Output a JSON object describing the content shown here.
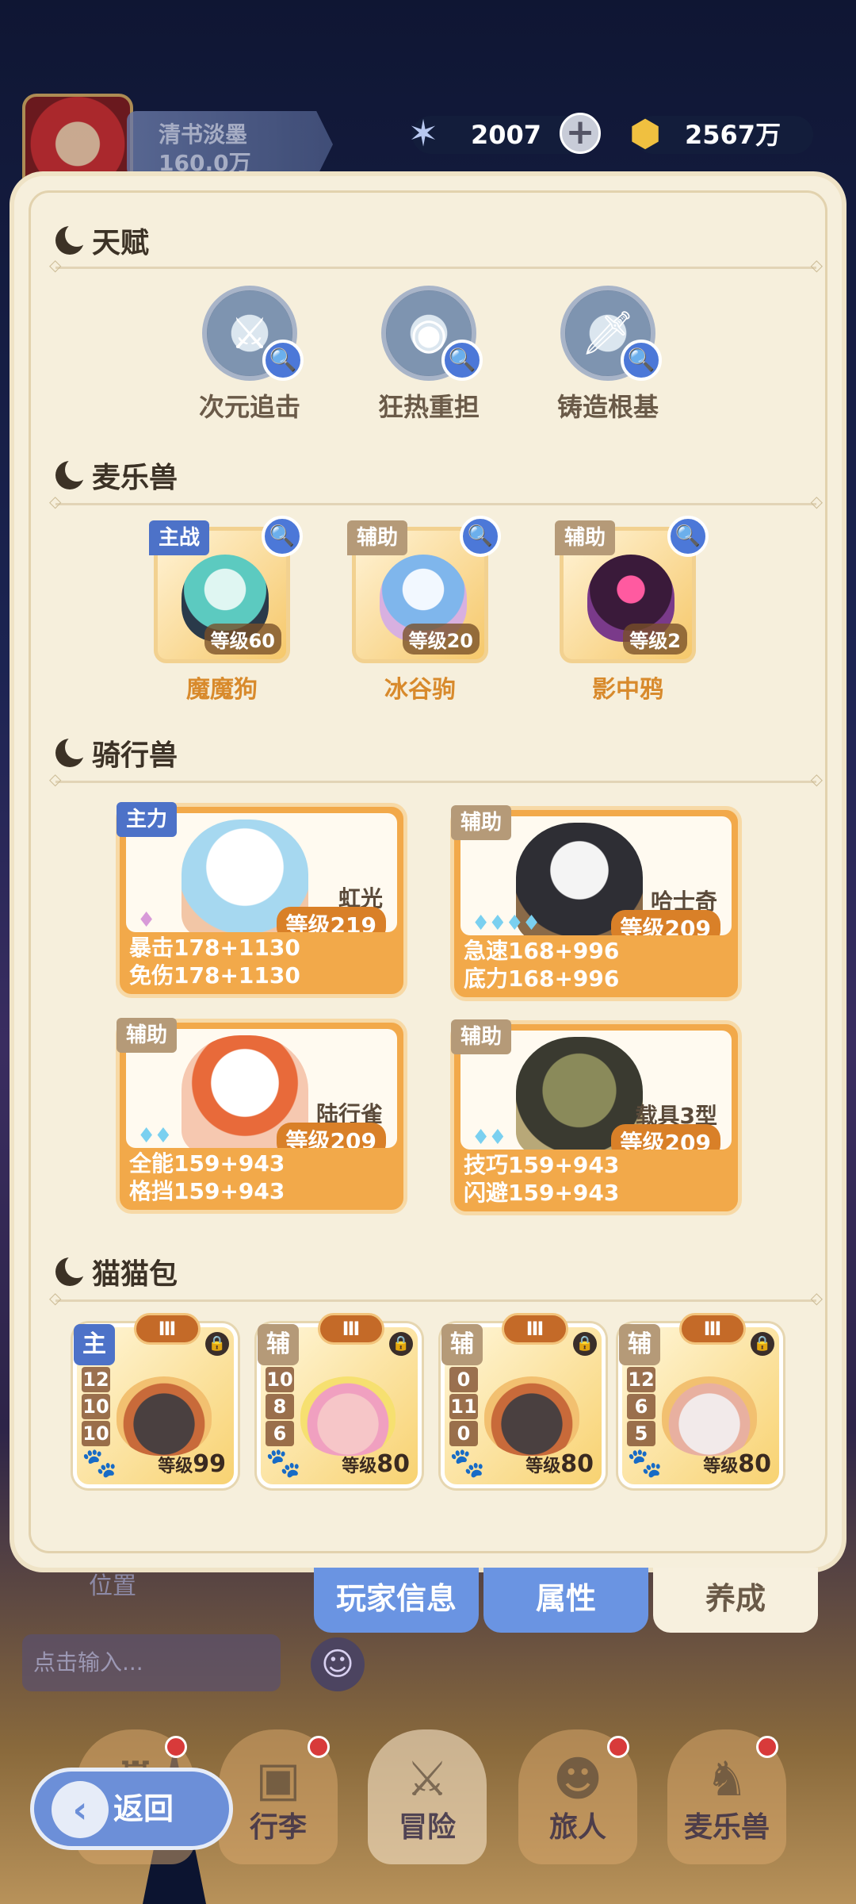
{
  "header": {
    "player_name": "清书淡墨",
    "player_power": "160.0万",
    "gem_count": "2007",
    "coin_count": "2567万",
    "gem_icon": "star-gem-icon",
    "coin_icon": "gold-coin-icon"
  },
  "sections": {
    "talent": "天赋",
    "pets": "麦乐兽",
    "mounts": "骑行兽",
    "cats": "猫猫包"
  },
  "talents": [
    {
      "label": "次元追击"
    },
    {
      "label": "狂热重担"
    },
    {
      "label": "铸造根基"
    }
  ],
  "pets": [
    {
      "tag": "主战",
      "name": "魔魔狗",
      "level": "等级60",
      "tag_color": "#4d72c8"
    },
    {
      "tag": "辅助",
      "name": "冰谷驹",
      "level": "等级20",
      "tag_color": "#b59a78"
    },
    {
      "tag": "辅助",
      "name": "影中鸦",
      "level": "等级2",
      "tag_color": "#b59a78"
    }
  ],
  "mounts": [
    {
      "tag": "主力",
      "name": "虹光",
      "level": "等级219",
      "stars": "♦",
      "stat1": "暴击178+1130",
      "stat2": "免伤178+1130"
    },
    {
      "tag": "辅助",
      "name": "哈士奇",
      "level": "等级209",
      "stars": "♦♦♦♦",
      "stat1": "急速168+996",
      "stat2": "底力168+996"
    },
    {
      "tag": "辅助",
      "name": "陆行雀",
      "level": "等级209",
      "stars": "♦♦",
      "stat1": "全能159+943",
      "stat2": "格挡159+943"
    },
    {
      "tag": "辅助",
      "name": "载具3型",
      "level": "等级209",
      "stars": "♦♦",
      "stat1": "技巧159+943",
      "stat2": "闪避159+943"
    }
  ],
  "cats": [
    {
      "tag": "主",
      "tier": "Ⅲ",
      "n1": "12",
      "n2": "10",
      "n3": "10",
      "level_label": "等级",
      "level": "99"
    },
    {
      "tag": "辅",
      "tier": "Ⅲ",
      "n1": "10",
      "n2": "8",
      "n3": "6",
      "level_label": "等级",
      "level": "80"
    },
    {
      "tag": "辅",
      "tier": "Ⅲ",
      "n1": "0",
      "n2": "11",
      "n3": "0",
      "level_label": "等级",
      "level": "80"
    },
    {
      "tag": "辅",
      "tier": "Ⅲ",
      "n1": "12",
      "n2": "6",
      "n3": "5",
      "level_label": "等级",
      "level": "80"
    }
  ],
  "tabs": {
    "player_info": "玩家信息",
    "attributes": "属性",
    "cultivate": "养成"
  },
  "position_label": "位置",
  "chat": {
    "placeholder": "点击输入..."
  },
  "nav": {
    "back": "返回",
    "luggage": "行李",
    "adventure": "冒险",
    "traveler": "旅人",
    "pets": "麦乐兽"
  },
  "colors": {
    "accent_blue": "#6a94e2",
    "orange": "#f2a94a",
    "tag_main": "#4d72c8",
    "tag_sub": "#b59a78"
  }
}
